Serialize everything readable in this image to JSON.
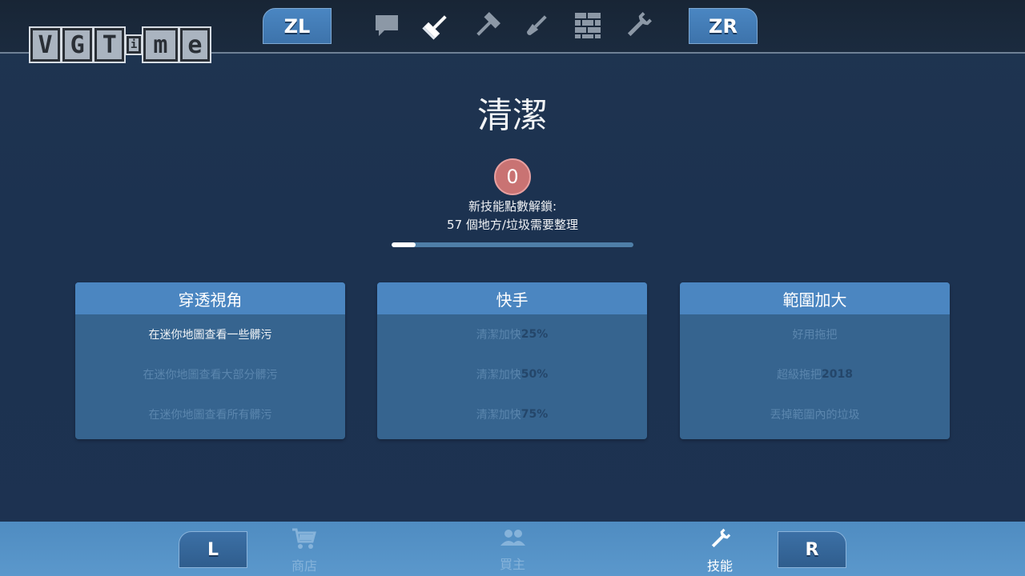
{
  "logo": {
    "letters": [
      "V",
      "G",
      "T",
      "i",
      "m",
      "e"
    ]
  },
  "top_nav": {
    "left_shoulder": "ZL",
    "right_shoulder": "ZR",
    "tabs": [
      {
        "icon": "chat-bubble-icon",
        "active": false
      },
      {
        "icon": "mop-icon",
        "active": true
      },
      {
        "icon": "hammer-icon",
        "active": false
      },
      {
        "icon": "paint-brush-icon",
        "active": false
      },
      {
        "icon": "brick-wall-icon",
        "active": false
      },
      {
        "icon": "wrench-icon",
        "active": false
      }
    ]
  },
  "page": {
    "title": "清潔",
    "skill_points": "0",
    "unlock_label": "新技能點數解鎖:",
    "unlock_requirement": "57 個地方/垃圾需要整理",
    "progress_fraction": 0.1
  },
  "skills": [
    {
      "title": "穿透視角",
      "tiers": [
        {
          "text": "在迷你地圖查看一些髒污",
          "bold": "",
          "unlocked": true
        },
        {
          "text": "在迷你地圖查看大部分髒污",
          "bold": "",
          "unlocked": false
        },
        {
          "text": "在迷你地圖查看所有髒污",
          "bold": "",
          "unlocked": false
        }
      ]
    },
    {
      "title": "快手",
      "tiers": [
        {
          "text": "清潔加快",
          "bold": "25%",
          "unlocked": false
        },
        {
          "text": "清潔加快",
          "bold": "50%",
          "unlocked": false
        },
        {
          "text": "清潔加快",
          "bold": "75%",
          "unlocked": false
        }
      ]
    },
    {
      "title": "範圍加大",
      "tiers": [
        {
          "text": "好用拖把",
          "bold": "",
          "unlocked": false
        },
        {
          "text": "超級拖把",
          "bold": "2018",
          "unlocked": false
        },
        {
          "text": "丟掉範圍內的垃圾",
          "bold": "",
          "unlocked": false
        }
      ]
    }
  ],
  "bottom_nav": {
    "left_shoulder": "L",
    "right_shoulder": "R",
    "items": [
      {
        "label": "商店",
        "icon": "shopping-cart-icon",
        "active": false
      },
      {
        "label": "買主",
        "icon": "people-icon",
        "active": false
      },
      {
        "label": "技能",
        "icon": "wrench-icon",
        "active": true
      }
    ]
  },
  "colors": {
    "background": "#1d3251",
    "card": "#36648f",
    "card_header": "#4b86c1",
    "points_badge": "#c97373",
    "bottom_bar": "#5390c4"
  }
}
